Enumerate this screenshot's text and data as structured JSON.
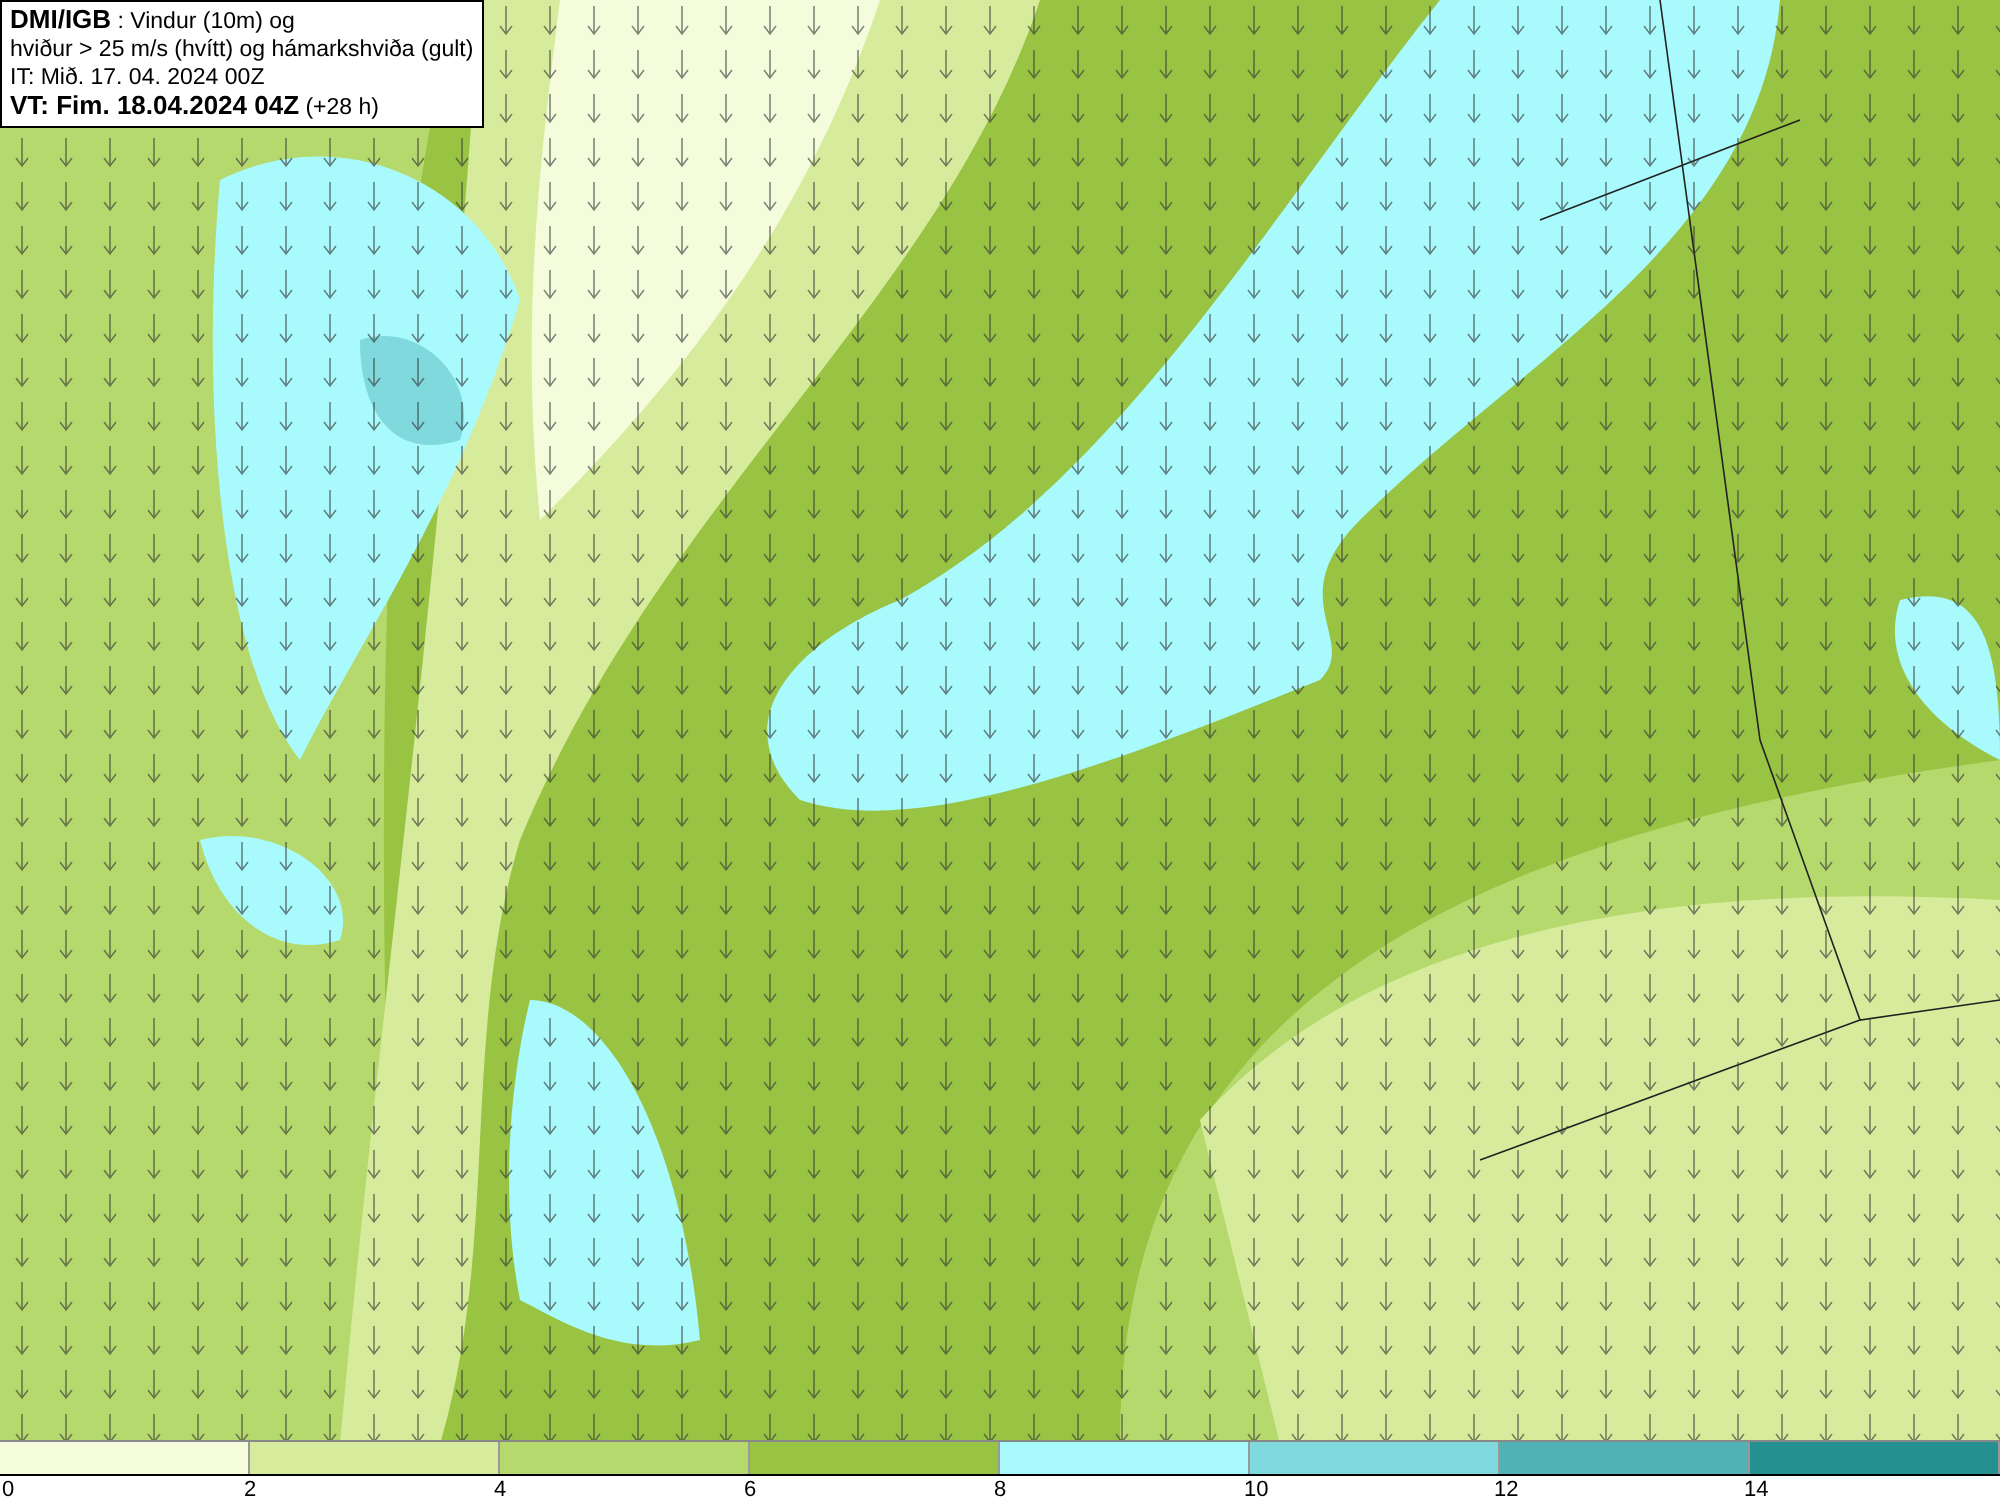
{
  "title_box": {
    "lines": [
      "**DMI/IGB** : Vindur (10m) og",
      "hviður > 25 m/s (hvítt) og hámarkshviða (gult)",
      "IT: Mið. 17. 04. 2024 00Z",
      "**VT: Fim. 18.04.2024 04Z** (+28 h)"
    ]
  },
  "legend": {
    "bins": [
      {
        "color": "#f4fcdc"
      },
      {
        "color": "#d6ec9c"
      },
      {
        "color": "#b5d96c"
      },
      {
        "color": "#98c343"
      },
      {
        "color": "#a8fafc"
      },
      {
        "color": "#80d9dc"
      },
      {
        "color": "#50b2b4"
      },
      {
        "color": "#24908f"
      }
    ],
    "labels": [
      "0",
      "2",
      "4",
      "6",
      "8",
      "10",
      "12",
      "14"
    ]
  }
}
